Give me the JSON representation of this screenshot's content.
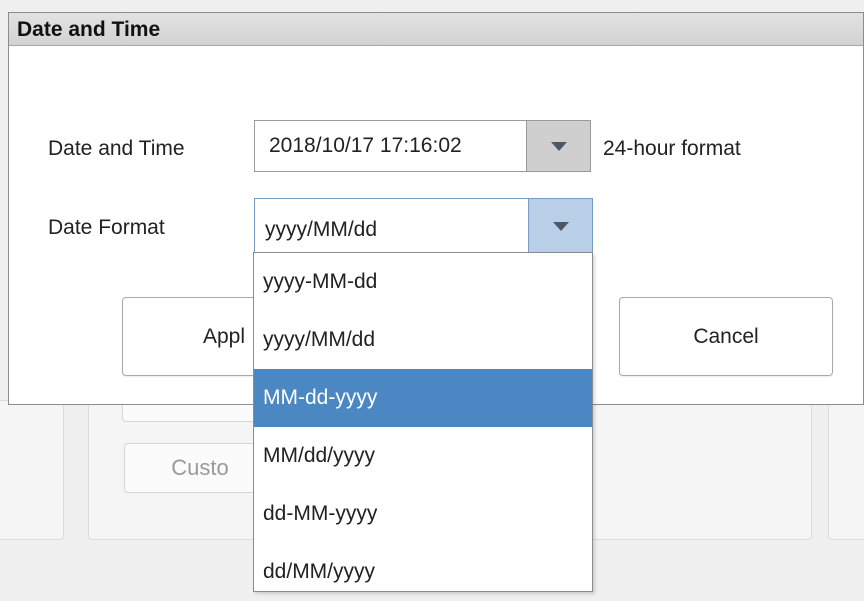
{
  "background": {
    "buttons": [
      "Custo"
    ]
  },
  "dialog": {
    "title": "Date and Time",
    "datetime": {
      "label": "Date and Time",
      "value": "2018/10/17 17:16:02",
      "hint": "24-hour format"
    },
    "date_format": {
      "label": "Date Format",
      "value": "yyyy/MM/dd"
    },
    "apply_label": "Appl",
    "cancel_label": "Cancel"
  },
  "dropdown": {
    "options": [
      "yyyy-MM-dd",
      "yyyy/MM/dd",
      "MM-dd-yyyy",
      "MM/dd/yyyy",
      "dd-MM-yyyy",
      "dd/MM/yyyy"
    ],
    "highlighted_index": 2
  },
  "colors": {
    "highlight": "#4b87c3",
    "title_bar": "#d8d8d8"
  }
}
